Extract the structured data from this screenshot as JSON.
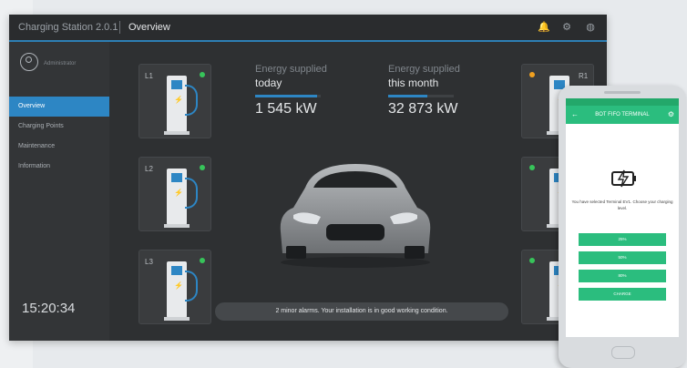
{
  "window": {
    "app_title": "Charging Station 2.0.1",
    "page_title": "Overview"
  },
  "titlebar_icons": [
    {
      "name": "bell-icon",
      "glyph": "🔔"
    },
    {
      "name": "gear-icon",
      "glyph": "⚙"
    },
    {
      "name": "user-menu-icon",
      "glyph": "◍"
    }
  ],
  "sidebar": {
    "username": "Administrator",
    "items": [
      {
        "label": "Overview",
        "active": true
      },
      {
        "label": "Charging Points",
        "active": false
      },
      {
        "label": "Maintenance",
        "active": false
      },
      {
        "label": "Information",
        "active": false
      }
    ],
    "clock": "15:20:34"
  },
  "stations_left": [
    {
      "label": "L1",
      "status": "green"
    },
    {
      "label": "L2",
      "status": "green"
    },
    {
      "label": "L3",
      "status": "green"
    }
  ],
  "stations_right": [
    {
      "label": "R1",
      "status": "orange"
    },
    {
      "label": "",
      "status": "green"
    },
    {
      "label": "",
      "status": "green"
    }
  ],
  "stats": [
    {
      "line1": "Energy supplied",
      "line2": "today",
      "value": "1 545 kW",
      "fill": 0.95
    },
    {
      "line1": "Energy supplied",
      "line2": "this month",
      "value": "32 873 kW",
      "fill": 0.6
    }
  ],
  "status_message": "2 minor alarms. Your installation is in good working condition.",
  "phone": {
    "title": "BOT FIFO TERMINAL",
    "message": "You have selected Terminal EV1. Choose your charging level.",
    "options": [
      "25%",
      "50%",
      "80%",
      "CHARGE"
    ]
  },
  "colors": {
    "accent": "#2d86c4",
    "ok": "#37c45a",
    "warn": "#f0a020",
    "mobile": "#2bbd7e"
  }
}
